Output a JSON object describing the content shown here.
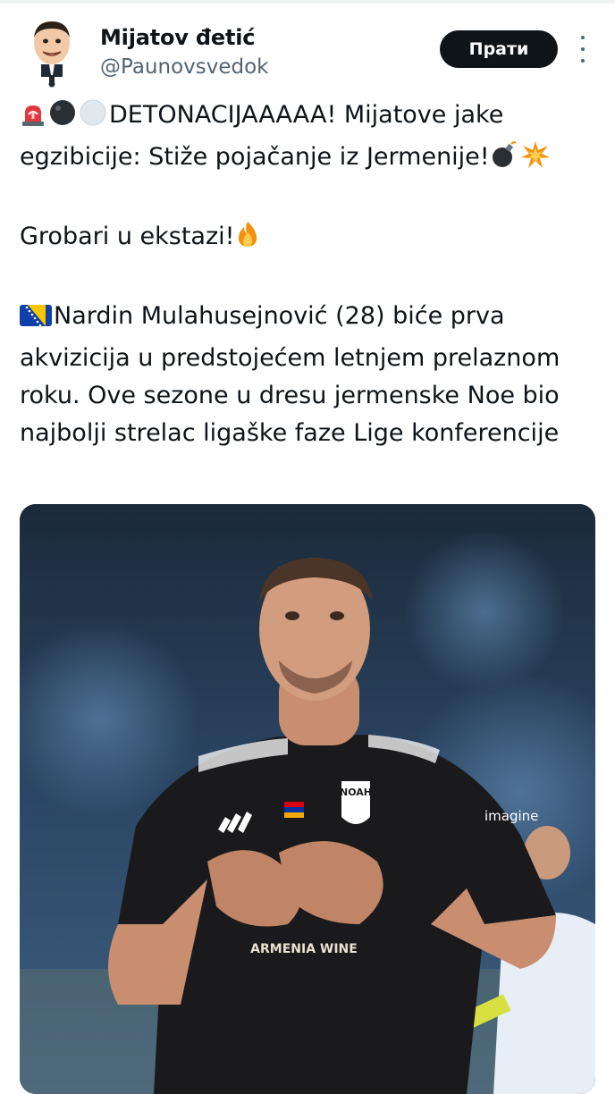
{
  "author": {
    "name": "Mijatov đetić",
    "handle": "@Paunovsvedok"
  },
  "follow_label": "Прати",
  "tweet": {
    "line1": "DETONACIJAAAAA! Mijatove jake egzibicije: Stiže pojačanje iz Jermenije!",
    "line2": "Grobari u ekstazi!",
    "line3": "Nardin Mulahusejnović (28) biće prva akvizicija u predstojećem letnjem prelaznom roku. Ove sezone u dresu jermenske Noe bio najbolji strelac ligaške faze Lige konferencije"
  },
  "photo": {
    "crest_text": "NOAH",
    "sponsor_brand": "imagine",
    "sponsor_sub": "ARMENIA WINE"
  },
  "icons": {
    "siren": "siren-icon",
    "black_circle": "black-circle-icon",
    "white_circle": "white-circle-icon",
    "bomb": "bomb-icon",
    "collision": "collision-icon",
    "fire": "fire-icon",
    "bosnia_flag": "bosnia-flag-icon",
    "more": "more-options-icon"
  },
  "colors": {
    "follow_button_bg": "#0f1419",
    "handle_text": "#536471",
    "text": "#0f1419"
  }
}
